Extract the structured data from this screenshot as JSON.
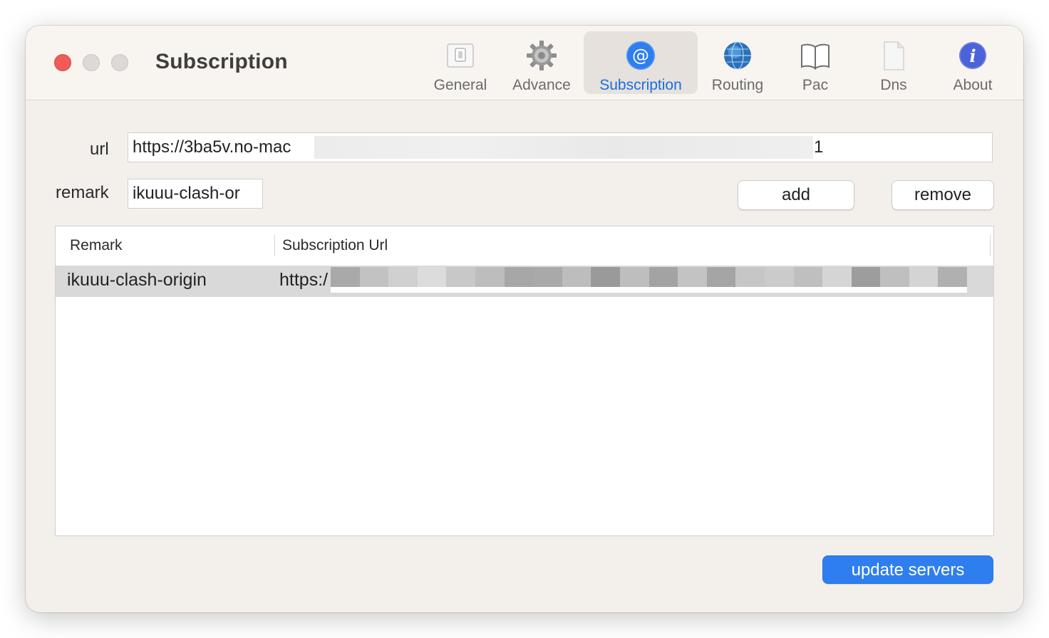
{
  "window": {
    "title": "Subscription"
  },
  "toolbar": {
    "items": [
      {
        "label": "General",
        "icon": "switch-icon"
      },
      {
        "label": "Advance",
        "icon": "gear-icon"
      },
      {
        "label": "Subscription",
        "icon": "at-sign-icon",
        "active": true
      },
      {
        "label": "Routing",
        "icon": "globe-icon"
      },
      {
        "label": "Pac",
        "icon": "book-icon"
      },
      {
        "label": "Dns",
        "icon": "document-icon"
      },
      {
        "label": "About",
        "icon": "info-icon"
      }
    ]
  },
  "form": {
    "url_label": "url",
    "url_value_start": "https://3ba5v.no-mac",
    "url_value_end": "1",
    "remark_label": "remark",
    "remark_value": "ikuuu-clash-or"
  },
  "buttons": {
    "add": "add",
    "remove": "remove",
    "update": "update servers"
  },
  "table": {
    "columns": [
      "Remark",
      "Subscription Url"
    ],
    "rows": [
      {
        "remark": "ikuuu-clash-origin",
        "url": "https:/"
      }
    ]
  },
  "colors": {
    "accent": "#2f7ef0",
    "active_tab_text": "#1a6fe0",
    "close": "#ee5c55",
    "window_bg": "#f3f0ec",
    "selected_row": "#d9d9d9"
  }
}
